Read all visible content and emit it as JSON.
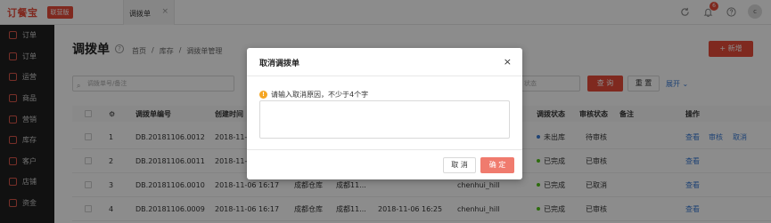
{
  "header": {
    "logo": "订餐宝",
    "badge": "联营版",
    "tab_label": "调拨单",
    "tab_close": "×",
    "notification_count": "6",
    "avatar_letter": "c"
  },
  "sidebar": {
    "items": [
      {
        "label": "订单",
        "icon": "order-icon"
      },
      {
        "label": "订单",
        "icon": "order-list-icon"
      },
      {
        "label": "运营",
        "icon": "operation-icon"
      },
      {
        "label": "商品",
        "icon": "goods-icon"
      },
      {
        "label": "营销",
        "icon": "marketing-icon"
      },
      {
        "label": "库存",
        "icon": "inventory-icon"
      },
      {
        "label": "客户",
        "icon": "customer-icon"
      },
      {
        "label": "店铺",
        "icon": "store-icon"
      },
      {
        "label": "资金",
        "icon": "funds-icon"
      }
    ]
  },
  "page": {
    "title": "调拨单",
    "help": "?",
    "breadcrumb": [
      "首页",
      "/",
      "库存",
      "/",
      "调拨单管理"
    ],
    "new_button": "+ 新增"
  },
  "filters": {
    "search_placeholder": "调拨单号/备注",
    "status_placeholder": "状态",
    "query_button": "查 询",
    "reset_button": "重 置",
    "expand_link": "展开 ⌄"
  },
  "table": {
    "headers": [
      "",
      "⚙",
      "调拨单编号",
      "创建时间",
      "",
      "",
      "",
      "",
      "调拨状态",
      "审核状态",
      "备注",
      "操作"
    ],
    "rows": [
      {
        "index": "1",
        "code": "DB.20181106.0012",
        "created": "2018-11-0",
        "out_wh": "",
        "in_wh": "",
        "time2": "",
        "user": "",
        "status": "未出库",
        "status_color": "#3a7bd5",
        "audit": "待审核",
        "actions": [
          "查看",
          "审核",
          "取消"
        ]
      },
      {
        "index": "2",
        "code": "DB.20181106.0011",
        "created": "2018-11-0",
        "out_wh": "",
        "in_wh": "",
        "time2": "",
        "user": "",
        "status": "已完成",
        "status_color": "#52c41a",
        "audit": "已审核",
        "actions": [
          "查看"
        ]
      },
      {
        "index": "3",
        "code": "DB.20181106.0010",
        "created": "2018-11-06 16:17",
        "out_wh": "成都仓库",
        "in_wh": "成都11...",
        "time2": "",
        "user": "chenhui_hill",
        "status": "已完成",
        "status_color": "#52c41a",
        "audit": "已取消",
        "actions": [
          "查看"
        ]
      },
      {
        "index": "4",
        "code": "DB.20181106.0009",
        "created": "2018-11-06 16:17",
        "out_wh": "成都仓库",
        "in_wh": "成都11...",
        "time2": "2018-11-06 16:25",
        "user": "chenhui_hill",
        "status": "已完成",
        "status_color": "#52c41a",
        "audit": "已审核",
        "actions": [
          "查看"
        ]
      }
    ]
  },
  "modal": {
    "title": "取消调拨单",
    "close": "×",
    "warn": "!",
    "hint": "请输入取消原因，不少于4个字",
    "textarea_value": "",
    "cancel_button": "取 消",
    "ok_button": "确 定"
  }
}
